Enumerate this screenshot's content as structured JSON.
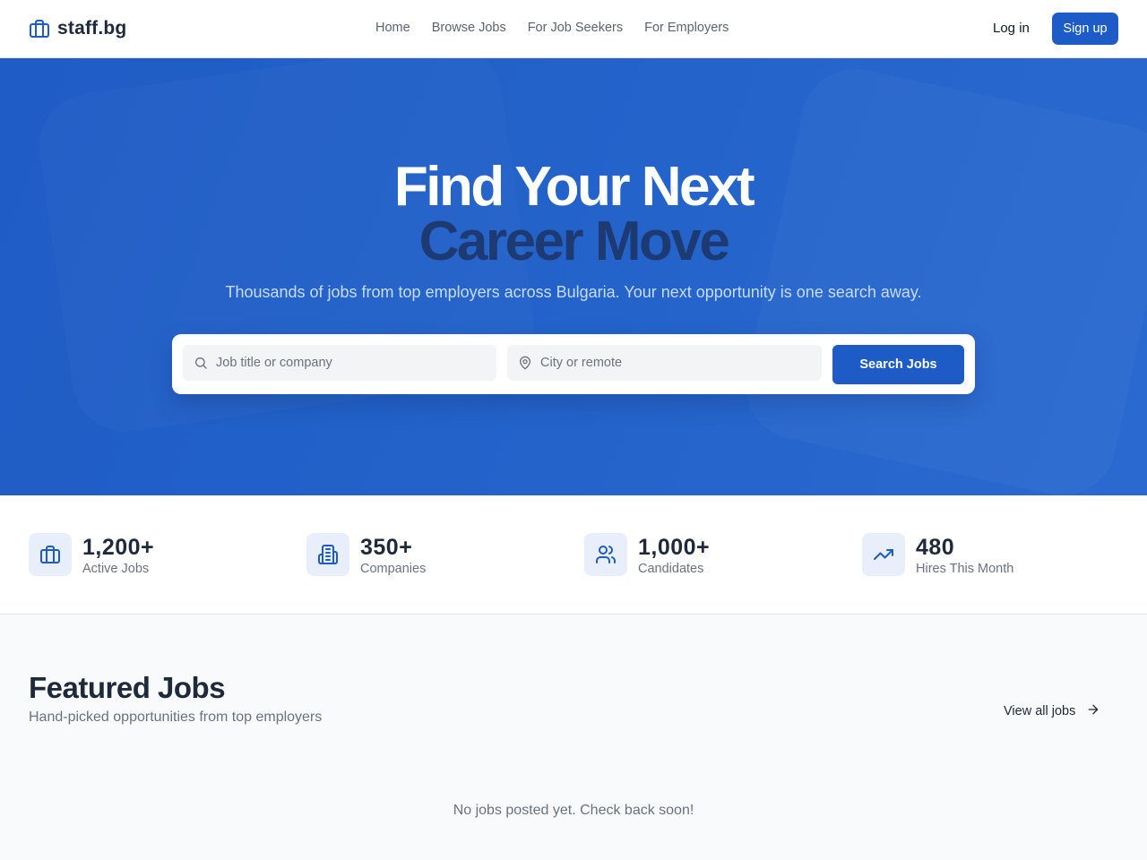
{
  "header": {
    "logo_text": "staff.bg",
    "logo_icon": "briefcase-icon",
    "nav": [
      "Home",
      "Browse Jobs",
      "For Job Seekers",
      "For Employers"
    ],
    "login_label": "Log in",
    "signup_label": "Sign up"
  },
  "hero": {
    "title_line1": "Find Your Next",
    "title_line2": "Career Move",
    "subtitle": "Thousands of jobs from top employers across Bulgaria. Your next opportunity is one search away.",
    "search": {
      "keyword_placeholder": "Job title or company",
      "keyword_value": "",
      "location_placeholder": "City or remote",
      "location_value": "",
      "button_label": "Search Jobs"
    }
  },
  "stats": [
    {
      "value": "1,200+",
      "label": "Active Jobs",
      "icon": "briefcase-icon"
    },
    {
      "value": "350+",
      "label": "Companies",
      "icon": "building-icon"
    },
    {
      "value": "1,000+",
      "label": "Candidates",
      "icon": "users-icon"
    },
    {
      "value": "480",
      "label": "Hires This Month",
      "icon": "trending-up-icon"
    }
  ],
  "featured": {
    "title": "Featured Jobs",
    "subtitle": "Hand-picked opportunities from top employers",
    "view_all_label": "View all jobs",
    "empty_message": "No jobs posted yet. Check back soon!"
  },
  "colors": {
    "brand": "#1d5bc6",
    "hero_bg": "#2262c9",
    "title_dark": "#1e3a73",
    "icon_bg": "#e8eefa"
  }
}
